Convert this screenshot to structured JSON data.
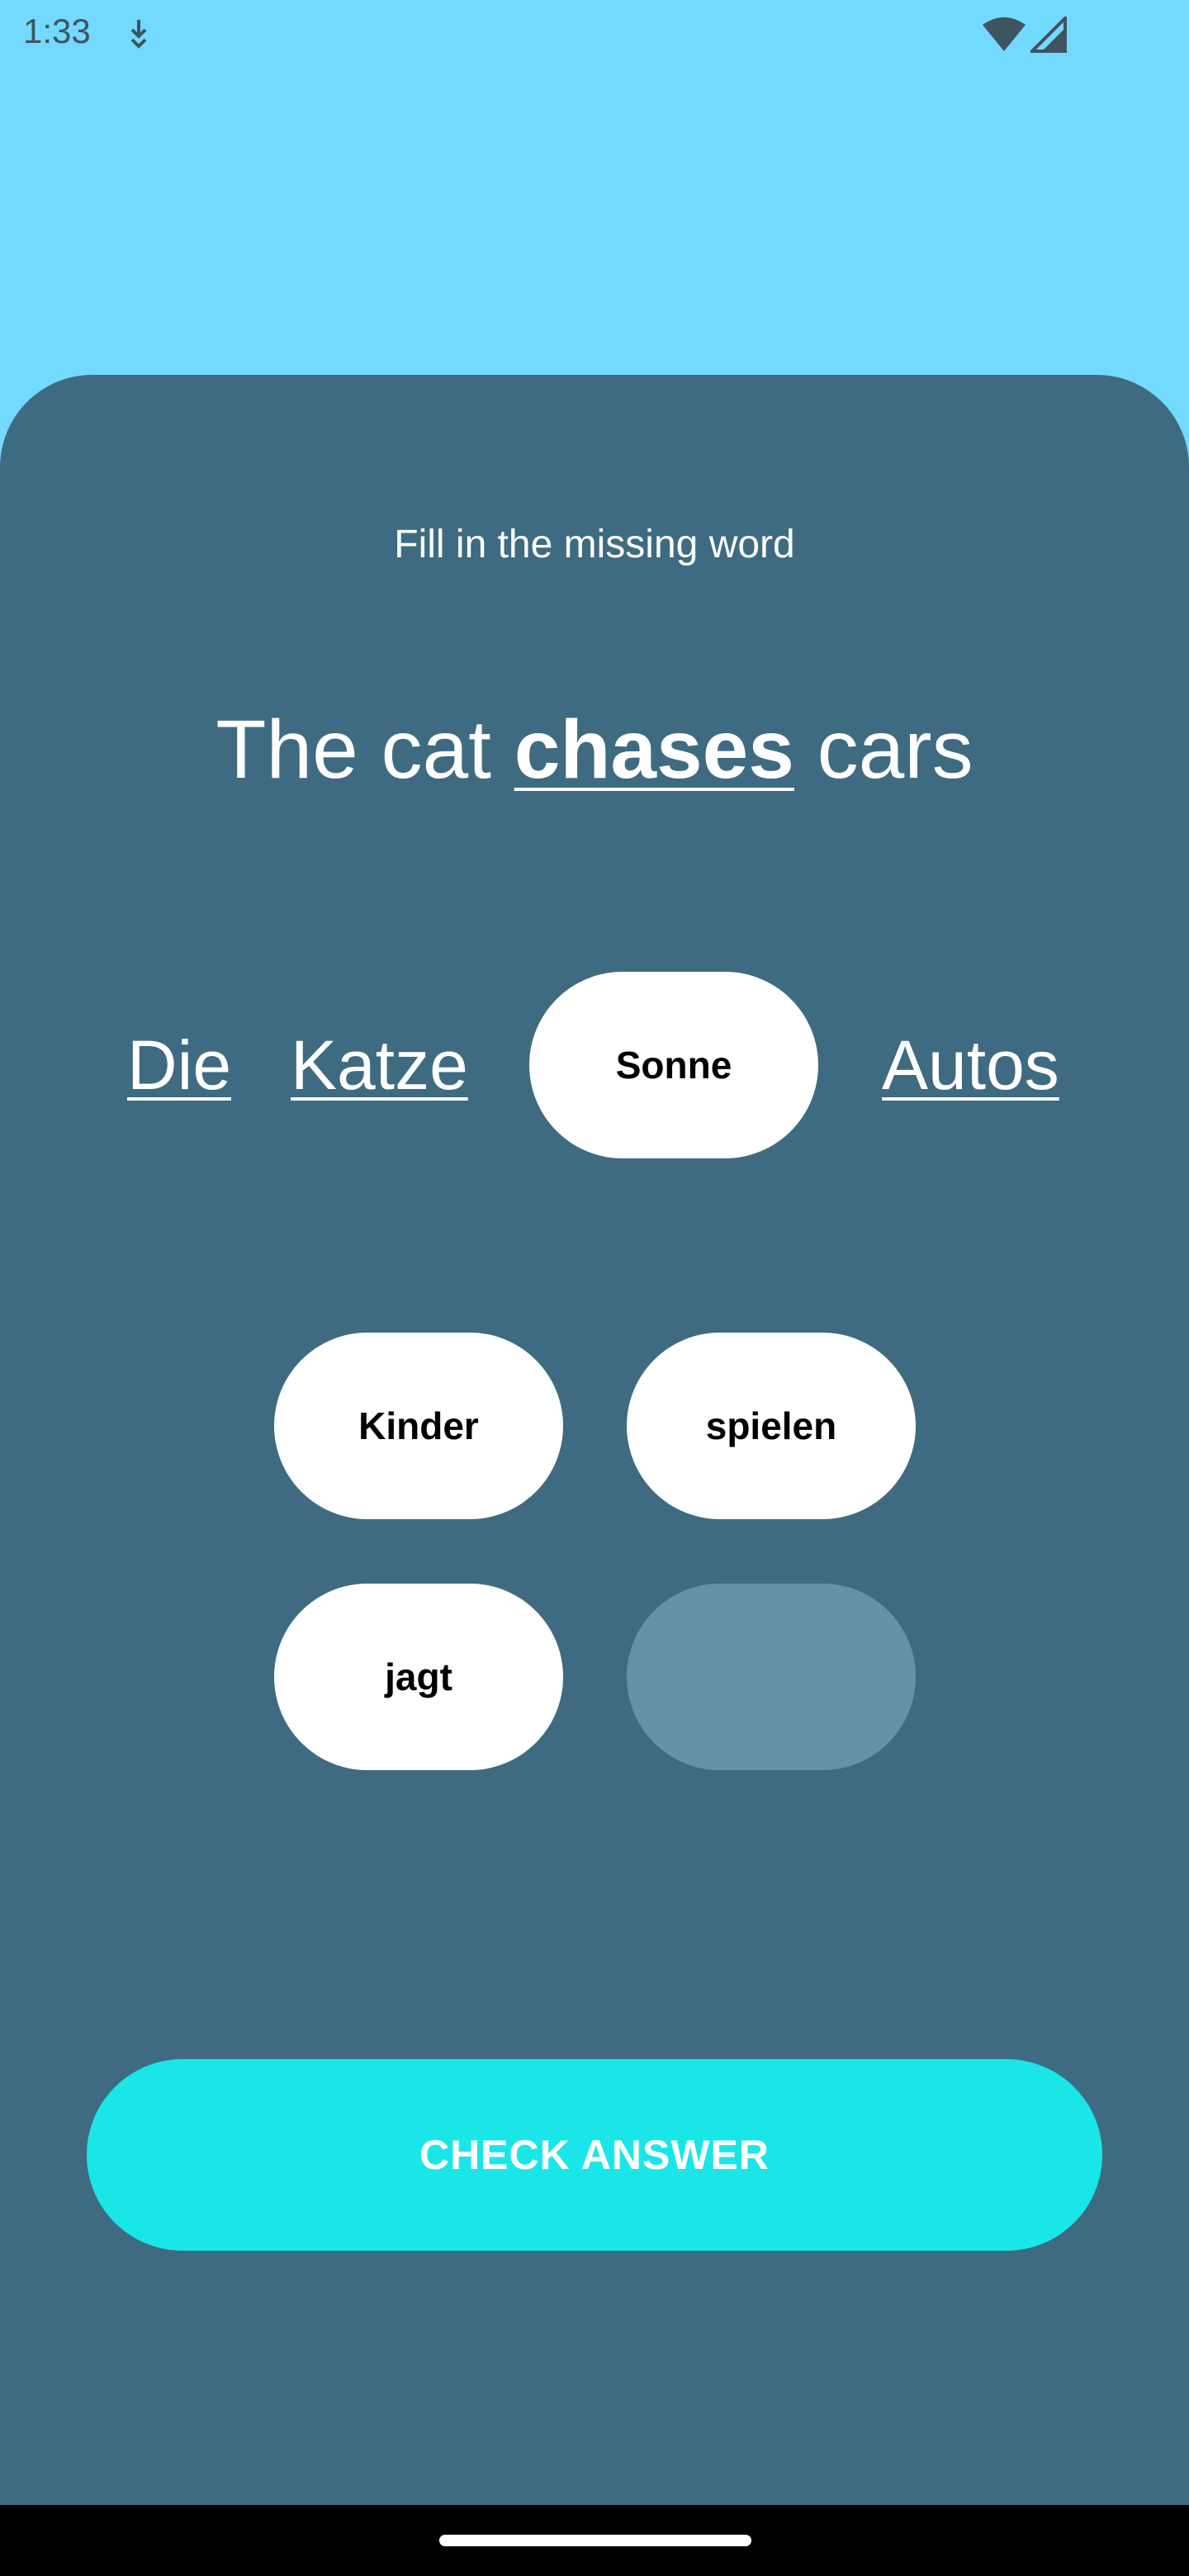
{
  "status_bar": {
    "time": "1:33",
    "icons": [
      "download-icon",
      "wifi-icon",
      "signal-icon"
    ]
  },
  "exercise": {
    "instruction": "Fill in the missing word",
    "sentence": {
      "before": "The cat ",
      "highlight": "chases",
      "after": " cars"
    },
    "answer_words": [
      "Die",
      "Katze",
      "Sonne",
      "Autos"
    ],
    "options": [
      "Kinder",
      "spielen",
      "jagt",
      ""
    ]
  },
  "actions": {
    "check_label": "CHECK ANSWER"
  },
  "colors": {
    "background": "#74d9fe",
    "card": "#3e6b81",
    "pill": "#ffffff",
    "empty_slot": "#6593a6",
    "button": "#1ae6e8"
  }
}
